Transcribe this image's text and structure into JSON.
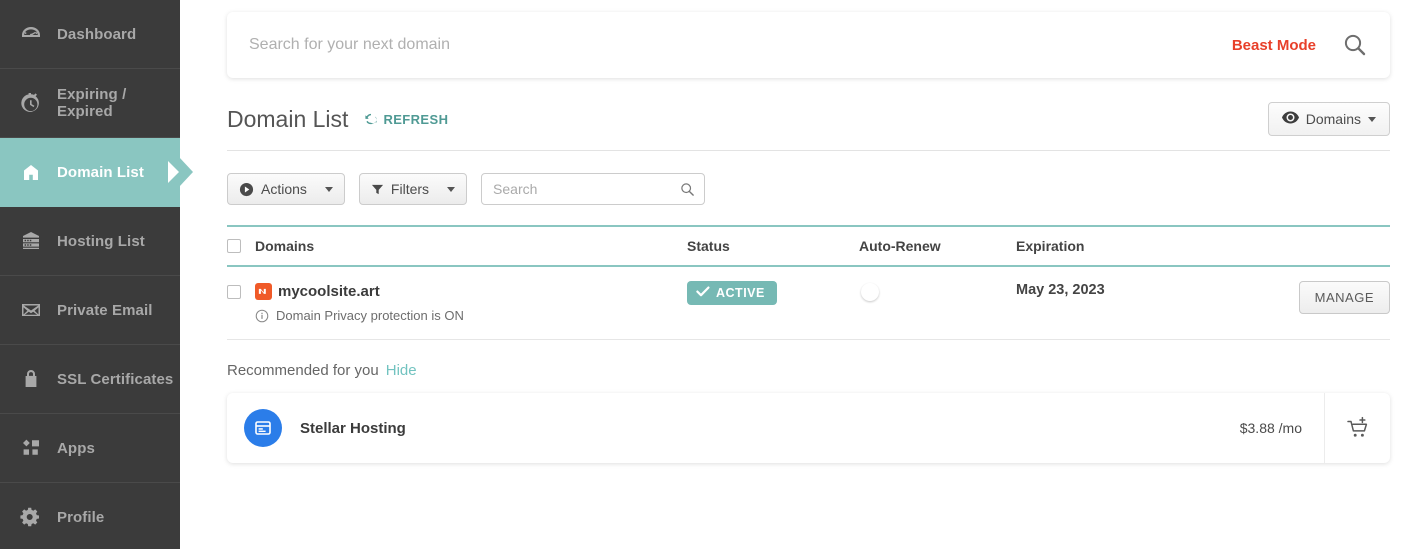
{
  "sidebar": {
    "items": [
      {
        "label": "Dashboard",
        "icon": "speedometer-icon",
        "active": false
      },
      {
        "label": "Expiring / Expired",
        "icon": "stopwatch-icon",
        "active": false
      },
      {
        "label": "Domain List",
        "icon": "house-icon",
        "active": true
      },
      {
        "label": "Hosting List",
        "icon": "server-icon",
        "active": false
      },
      {
        "label": "Private Email",
        "icon": "envelope-icon",
        "active": false
      },
      {
        "label": "SSL Certificates",
        "icon": "lock-icon",
        "active": false
      },
      {
        "label": "Apps",
        "icon": "apps-grid-icon",
        "active": false
      },
      {
        "label": "Profile",
        "icon": "gear-icon",
        "active": false
      }
    ],
    "active_color": "#8ac6c1",
    "background_color": "#3b3b3b"
  },
  "top_search": {
    "placeholder": "Search for your next domain",
    "value": "",
    "beast_mode_label": "Beast Mode",
    "beast_mode_color": "#e8402a",
    "search_icon": "magnifier-icon"
  },
  "panel": {
    "title": "Domain List",
    "refresh_label": "REFRESH",
    "refresh_icon": "refresh-icon",
    "refresh_color": "#4f9a94",
    "view_selector": {
      "label": "Domains",
      "icon": "eye-icon",
      "caret": "chevron-down-icon"
    }
  },
  "toolbar": {
    "actions_label": "Actions",
    "actions_icon": "play-circle-icon",
    "filters_label": "Filters",
    "filters_icon": "funnel-icon",
    "search_placeholder": "Search",
    "search_value": "",
    "search_icon": "magnifier-icon"
  },
  "table": {
    "headers": {
      "domains": "Domains",
      "status": "Status",
      "auto_renew": "Auto-Renew",
      "expiration": "Expiration"
    },
    "accent_color": "#8ac6c1",
    "rows": [
      {
        "checked": false,
        "favicon": "namecheap-logo-icon",
        "favicon_color": "#f05a28",
        "domain": "mycoolsite.art",
        "privacy_note": "Domain Privacy protection is ON",
        "privacy_icon": "info-circle-icon",
        "status": "ACTIVE",
        "status_icon": "check-icon",
        "status_color": "#76b9b4",
        "auto_renew": false,
        "expiration": "May 23, 2023",
        "manage_label": "MANAGE"
      }
    ]
  },
  "annotation": {
    "target": "manage-button",
    "color": "#8d0d3f"
  },
  "recommended": {
    "title": "Recommended for you",
    "hide_label": "Hide",
    "hide_color": "#72c3c0",
    "items": [
      {
        "name": "Stellar Hosting",
        "icon": "hosting-panel-icon",
        "icon_color": "#2b7de9",
        "price": "$3.88 /mo",
        "cart_icon": "add-to-cart-icon"
      }
    ]
  }
}
